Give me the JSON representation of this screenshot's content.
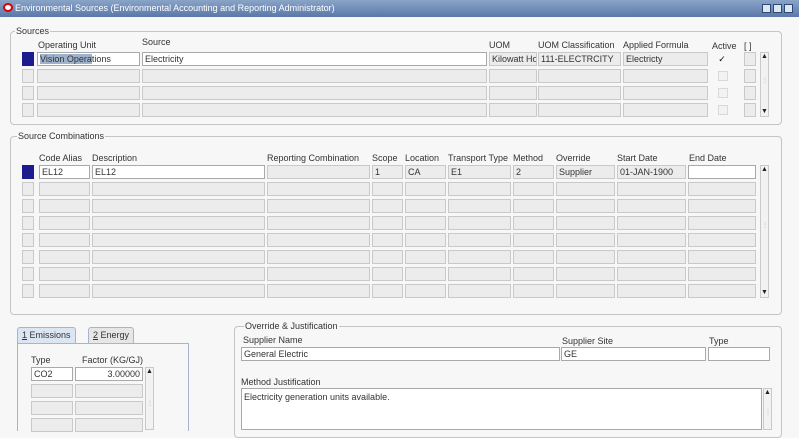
{
  "window": {
    "title": "Environmental Sources (Environmental Accounting and Reporting Administrator)"
  },
  "sources": {
    "title": "Sources",
    "headers": {
      "operating_unit": "Operating Unit",
      "source": "Source",
      "uom": "UOM",
      "uom_classification": "UOM Classification",
      "applied_formula": "Applied Formula",
      "active": "Active",
      "dff": "[ ]"
    },
    "rows": [
      {
        "operating_unit_selected": "Vision Opera",
        "operating_unit_rest": "tions",
        "source": "Electricity",
        "uom": "Kilowatt Ho",
        "uom_classification": "111-ELECTRCITY",
        "applied_formula": "Electricty",
        "active_mark": "✓"
      }
    ]
  },
  "combinations": {
    "title": "Source Combinations",
    "headers": {
      "code_alias": "Code Alias",
      "description": "Description",
      "reporting_combination": "Reporting Combination",
      "scope": "Scope",
      "location": "Location",
      "transport_type": "Transport Type",
      "method": "Method",
      "override": "Override",
      "start_date": "Start Date",
      "end_date": "End Date"
    },
    "rows": [
      {
        "code_alias": "EL12",
        "description": "EL12",
        "reporting_combination": "",
        "scope": "1",
        "location": "CA",
        "transport_type": "E1",
        "method": "2",
        "override": "Supplier",
        "start_date": "01-JAN-1900",
        "end_date": ""
      }
    ]
  },
  "tabs": {
    "emissions_num": "1",
    "emissions": " Emissions",
    "energy_num": "2",
    "energy": " Energy"
  },
  "emissions": {
    "headers": {
      "type": "Type",
      "factor": "Factor (KG/GJ)"
    },
    "rows": [
      {
        "type": "CO2",
        "factor": "3.00000"
      }
    ]
  },
  "override": {
    "title": "Override & Justification",
    "supplier_name_label": "Supplier Name",
    "supplier_name": "General Electric",
    "supplier_site_label": "Supplier Site",
    "supplier_site": "GE",
    "type_label": "Type",
    "type_value": "",
    "method_justification_label": "Method Justification",
    "method_justification": "Electricity generation units available."
  },
  "icons": {
    "app_icon": "oracle-logo-icon",
    "minimize": "minimize-icon",
    "maximize": "maximize-icon",
    "close": "close-icon",
    "scroll_up": "scroll-up-arrow-icon",
    "scroll_down": "scroll-down-arrow-icon"
  },
  "colors": {
    "title_bar": "#5a78a8",
    "selected_record": "#1c1c8c",
    "field_text_highlight": "#9eb2cc"
  }
}
